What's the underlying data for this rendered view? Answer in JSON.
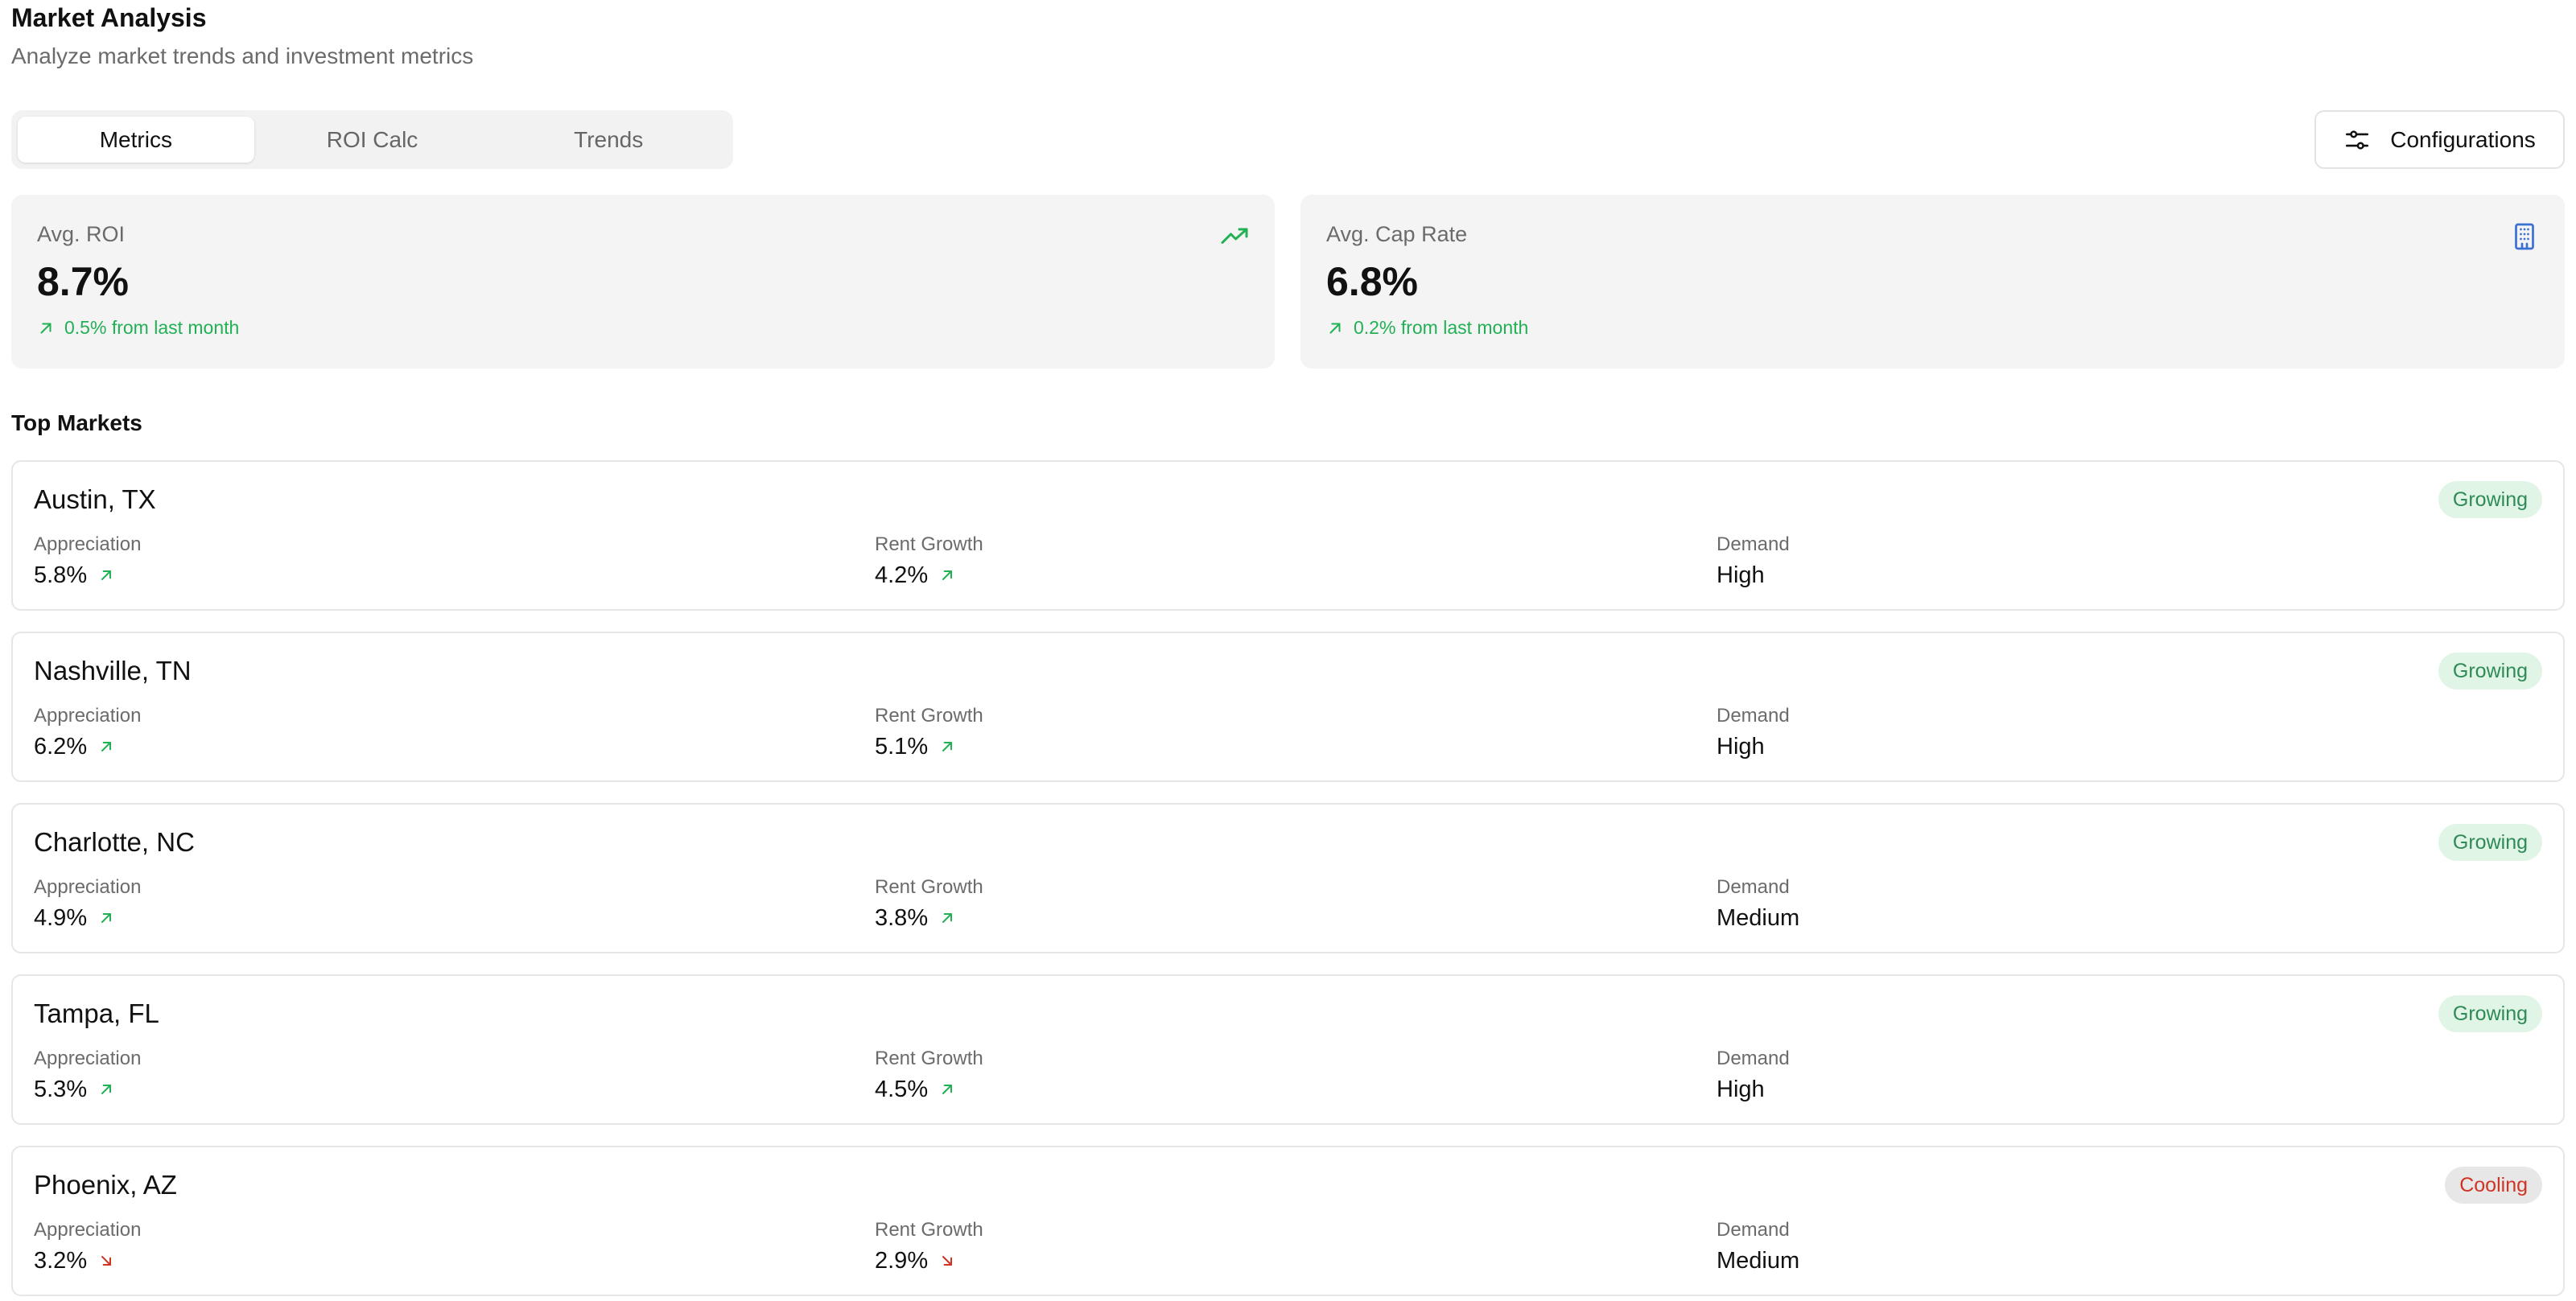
{
  "header": {
    "title": "Market Analysis",
    "subtitle": "Analyze market trends and investment metrics"
  },
  "tabs": [
    {
      "label": "Metrics",
      "active": true
    },
    {
      "label": "ROI Calc",
      "active": false
    },
    {
      "label": "Trends",
      "active": false
    }
  ],
  "config_button": {
    "label": "Configurations",
    "icon": "sliders-icon"
  },
  "metrics": [
    {
      "label": "Avg. ROI",
      "value": "8.7%",
      "change": "0.5% from last month",
      "icon": "trending-up-icon",
      "icon_color": "#22b055"
    },
    {
      "label": "Avg. Cap Rate",
      "value": "6.8%",
      "change": "0.2% from last month",
      "icon": "building-icon",
      "icon_color": "#3b6fd4"
    }
  ],
  "section_title": "Top Markets",
  "column_labels": {
    "appreciation": "Appreciation",
    "rent_growth": "Rent Growth",
    "demand": "Demand"
  },
  "markets": [
    {
      "name": "Austin, TX",
      "status": "Growing",
      "appreciation": "5.8%",
      "appreciation_trend": "up",
      "rent_growth": "4.2%",
      "rent_trend": "up",
      "demand": "High"
    },
    {
      "name": "Nashville, TN",
      "status": "Growing",
      "appreciation": "6.2%",
      "appreciation_trend": "up",
      "rent_growth": "5.1%",
      "rent_trend": "up",
      "demand": "High"
    },
    {
      "name": "Charlotte, NC",
      "status": "Growing",
      "appreciation": "4.9%",
      "appreciation_trend": "up",
      "rent_growth": "3.8%",
      "rent_trend": "up",
      "demand": "Medium"
    },
    {
      "name": "Tampa, FL",
      "status": "Growing",
      "appreciation": "5.3%",
      "appreciation_trend": "up",
      "rent_growth": "4.5%",
      "rent_trend": "up",
      "demand": "High"
    },
    {
      "name": "Phoenix, AZ",
      "status": "Cooling",
      "appreciation": "3.2%",
      "appreciation_trend": "down",
      "rent_growth": "2.9%",
      "rent_trend": "down",
      "demand": "Medium"
    }
  ],
  "colors": {
    "up": "#22b055",
    "down": "#d03424",
    "growing_bg": "#e1f5e6",
    "cooling_bg": "#e7e7e7"
  }
}
